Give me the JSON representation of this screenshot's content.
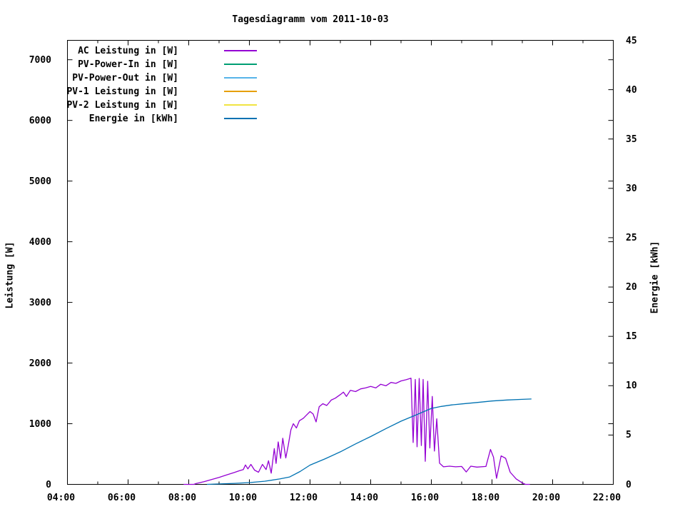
{
  "title": "Tagesdiagramm vom 2011-10-03",
  "axes": {
    "x": {
      "range_hours": [
        4,
        22
      ],
      "major_ticks": [
        4,
        6,
        8,
        10,
        12,
        14,
        16,
        18,
        20,
        22
      ],
      "major_labels": [
        "04:00",
        "06:00",
        "08:00",
        "10:00",
        "12:00",
        "14:00",
        "16:00",
        "18:00",
        "20:00",
        "22:00"
      ],
      "minor_ticks": [
        5,
        7,
        9,
        11,
        13,
        15,
        17,
        19,
        21
      ]
    },
    "y_left": {
      "label": "Leistung [W]",
      "range": [
        0,
        7320
      ],
      "ticks": [
        0,
        1000,
        2000,
        3000,
        4000,
        5000,
        6000,
        7000
      ],
      "tick_labels": [
        "0",
        "1000",
        "2000",
        "3000",
        "4000",
        "5000",
        "6000",
        "7000"
      ]
    },
    "y_right": {
      "label": "Energie [kWh]",
      "range": [
        0,
        45
      ],
      "ticks": [
        0,
        5,
        10,
        15,
        20,
        25,
        30,
        35,
        40,
        45
      ],
      "tick_labels": [
        "0",
        "5",
        "10",
        "15",
        "20",
        "25",
        "30",
        "35",
        "40",
        "45"
      ]
    }
  },
  "legend": {
    "items": [
      {
        "label": "AC Leistung in [W]",
        "color": "#9400d3"
      },
      {
        "label": "PV-Power-In in [W]",
        "color": "#009e73"
      },
      {
        "label": "PV-Power-Out in [W]",
        "color": "#56b4e9"
      },
      {
        "label": "PV-1 Leistung in [W]",
        "color": "#e69f00"
      },
      {
        "label": "PV-2 Leistung in [W]",
        "color": "#f0e442"
      },
      {
        "label": "Energie in [kWh]",
        "color": "#0072b2"
      }
    ]
  },
  "chart_data": {
    "type": "line",
    "title": "Tagesdiagramm vom 2011-10-03",
    "xlabel": "",
    "x_unit": "hour_of_day",
    "x_range": [
      4,
      22
    ],
    "ylabel_left": "Leistung [W]",
    "ylim_left": [
      0,
      7320
    ],
    "ylabel_right": "Energie [kWh]",
    "ylim_right": [
      0,
      45
    ],
    "grid": false,
    "legend_position": "top-left-inside",
    "series": [
      {
        "name": "AC Leistung in [W]",
        "color": "#9400d3",
        "axis": "left",
        "visible": true,
        "points": [
          [
            7.83,
            0
          ],
          [
            8.17,
            0
          ],
          [
            8.25,
            15
          ],
          [
            8.5,
            45
          ],
          [
            8.75,
            80
          ],
          [
            9.0,
            115
          ],
          [
            9.25,
            155
          ],
          [
            9.5,
            195
          ],
          [
            9.67,
            225
          ],
          [
            9.8,
            245
          ],
          [
            9.87,
            320
          ],
          [
            9.95,
            255
          ],
          [
            10.05,
            330
          ],
          [
            10.17,
            235
          ],
          [
            10.3,
            200
          ],
          [
            10.43,
            330
          ],
          [
            10.55,
            245
          ],
          [
            10.63,
            390
          ],
          [
            10.72,
            185
          ],
          [
            10.82,
            590
          ],
          [
            10.88,
            345
          ],
          [
            10.95,
            700
          ],
          [
            11.03,
            430
          ],
          [
            11.1,
            760
          ],
          [
            11.2,
            435
          ],
          [
            11.28,
            640
          ],
          [
            11.37,
            900
          ],
          [
            11.45,
            1000
          ],
          [
            11.55,
            930
          ],
          [
            11.65,
            1050
          ],
          [
            11.78,
            1090
          ],
          [
            11.88,
            1140
          ],
          [
            12.0,
            1200
          ],
          [
            12.1,
            1160
          ],
          [
            12.2,
            1030
          ],
          [
            12.3,
            1280
          ],
          [
            12.42,
            1330
          ],
          [
            12.55,
            1300
          ],
          [
            12.7,
            1390
          ],
          [
            12.83,
            1420
          ],
          [
            13.0,
            1480
          ],
          [
            13.1,
            1520
          ],
          [
            13.2,
            1450
          ],
          [
            13.33,
            1550
          ],
          [
            13.5,
            1530
          ],
          [
            13.67,
            1575
          ],
          [
            13.83,
            1590
          ],
          [
            14.0,
            1615
          ],
          [
            14.17,
            1590
          ],
          [
            14.33,
            1650
          ],
          [
            14.5,
            1625
          ],
          [
            14.67,
            1680
          ],
          [
            14.83,
            1665
          ],
          [
            15.0,
            1705
          ],
          [
            15.17,
            1725
          ],
          [
            15.33,
            1750
          ],
          [
            15.4,
            690
          ],
          [
            15.47,
            1730
          ],
          [
            15.53,
            620
          ],
          [
            15.6,
            1745
          ],
          [
            15.67,
            640
          ],
          [
            15.73,
            1730
          ],
          [
            15.8,
            380
          ],
          [
            15.88,
            1700
          ],
          [
            15.95,
            600
          ],
          [
            16.03,
            1450
          ],
          [
            16.1,
            550
          ],
          [
            16.18,
            1080
          ],
          [
            16.27,
            350
          ],
          [
            16.4,
            290
          ],
          [
            16.6,
            300
          ],
          [
            16.8,
            290
          ],
          [
            17.0,
            295
          ],
          [
            17.15,
            205
          ],
          [
            17.3,
            300
          ],
          [
            17.5,
            285
          ],
          [
            17.8,
            295
          ],
          [
            17.95,
            575
          ],
          [
            18.05,
            450
          ],
          [
            18.15,
            100
          ],
          [
            18.3,
            470
          ],
          [
            18.45,
            430
          ],
          [
            18.6,
            200
          ],
          [
            18.8,
            90
          ],
          [
            19.0,
            25
          ],
          [
            19.1,
            0
          ],
          [
            19.25,
            0
          ]
        ]
      },
      {
        "name": "PV-Power-In in [W]",
        "color": "#009e73",
        "axis": "left",
        "visible": false,
        "points": []
      },
      {
        "name": "PV-Power-Out in [W]",
        "color": "#56b4e9",
        "axis": "left",
        "visible": false,
        "points": []
      },
      {
        "name": "PV-1 Leistung in [W]",
        "color": "#e69f00",
        "axis": "left",
        "visible": false,
        "points": []
      },
      {
        "name": "PV-2 Leistung in [W]",
        "color": "#f0e442",
        "axis": "left",
        "visible": false,
        "points": []
      },
      {
        "name": "Energie in [kWh]",
        "color": "#0072b2",
        "axis": "right",
        "visible": true,
        "points": [
          [
            8.6,
            0
          ],
          [
            9.0,
            0.04
          ],
          [
            9.5,
            0.1
          ],
          [
            10.0,
            0.18
          ],
          [
            10.5,
            0.32
          ],
          [
            11.0,
            0.55
          ],
          [
            11.33,
            0.75
          ],
          [
            11.67,
            1.3
          ],
          [
            12.0,
            1.95
          ],
          [
            12.5,
            2.6
          ],
          [
            13.0,
            3.3
          ],
          [
            13.5,
            4.1
          ],
          [
            14.0,
            4.85
          ],
          [
            14.5,
            5.65
          ],
          [
            15.0,
            6.4
          ],
          [
            15.5,
            7.05
          ],
          [
            16.0,
            7.7
          ],
          [
            16.33,
            7.9
          ],
          [
            16.67,
            8.05
          ],
          [
            17.0,
            8.15
          ],
          [
            17.5,
            8.3
          ],
          [
            18.0,
            8.45
          ],
          [
            18.5,
            8.55
          ],
          [
            19.0,
            8.62
          ],
          [
            19.3,
            8.65
          ]
        ]
      }
    ]
  }
}
